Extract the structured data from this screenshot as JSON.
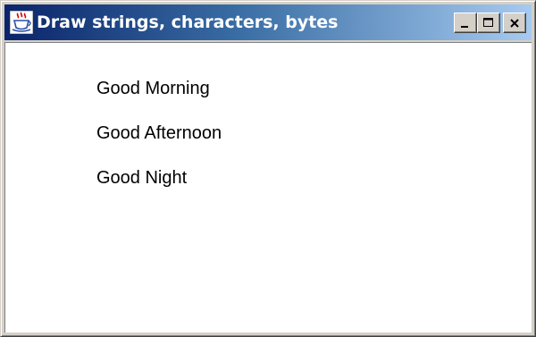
{
  "window": {
    "title": "Draw strings, characters, bytes",
    "icon": "java-cup-icon"
  },
  "controls": {
    "minimize": "minimize-icon",
    "maximize": "maximize-icon",
    "close": "close-icon"
  },
  "content": {
    "lines": [
      "Good Morning",
      "Good Afternoon",
      "Good Night"
    ]
  },
  "colors": {
    "titlebar_start": "#0a246a",
    "titlebar_end": "#a6caf0",
    "frame": "#d4d0c8",
    "client_bg": "#ffffff",
    "text": "#000000"
  }
}
